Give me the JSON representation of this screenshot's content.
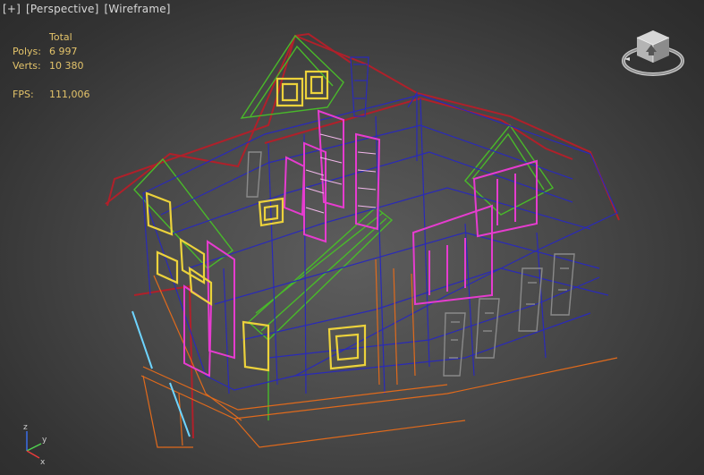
{
  "viewport": {
    "labels": [
      "[+]",
      "[Perspective]",
      "[Wireframe]"
    ]
  },
  "stats": {
    "header": "Total",
    "polys_label": "Polys:",
    "polys_value": "6 997",
    "verts_label": "Verts:",
    "verts_value": "10 380",
    "fps_label": "FPS:",
    "fps_value": "111,006"
  },
  "axis": {
    "x": "x",
    "y": "y",
    "z": "z"
  },
  "colors": {
    "roof": "#b0202a",
    "green": "#49b92a",
    "blue": "#2a2ab8",
    "pink": "#e63ccf",
    "yellow": "#ecd23b",
    "orange": "#e06a1c",
    "grey": "#8a8a8a",
    "cyan": "#6ed4ff",
    "stat_text": "#e3c36a",
    "label_text": "#d8d8d8"
  }
}
